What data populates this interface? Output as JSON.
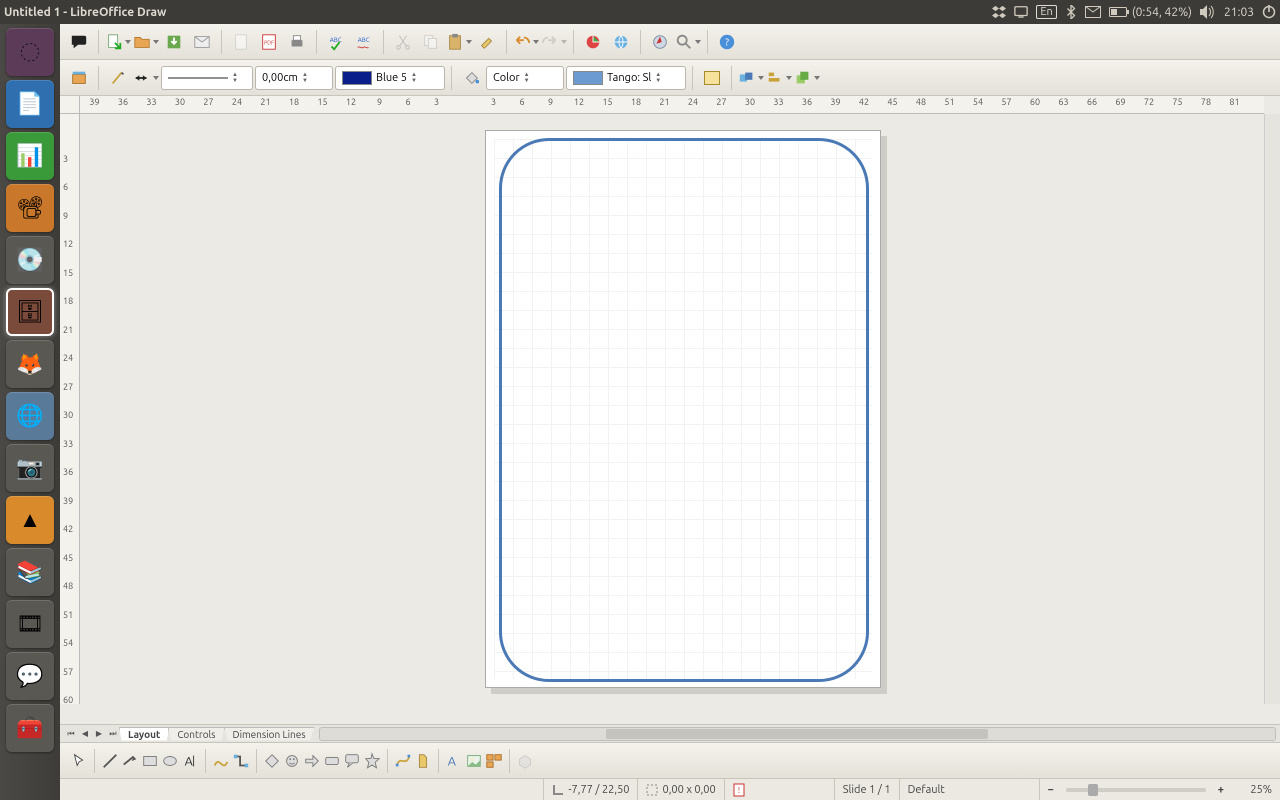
{
  "menubar": {
    "title": "Untitled 1 - LibreOffice Draw",
    "lang": "En",
    "battery": "(0:54, 42%)",
    "clock": "21:03"
  },
  "launcher": {
    "items": [
      {
        "name": "dash",
        "glyph": "◌"
      },
      {
        "name": "writer",
        "glyph": "📄"
      },
      {
        "name": "calc",
        "glyph": "📊"
      },
      {
        "name": "impress",
        "glyph": "📽"
      },
      {
        "name": "disk",
        "glyph": "💽"
      },
      {
        "name": "files",
        "glyph": "🗄"
      },
      {
        "name": "gimp",
        "glyph": "🦊"
      },
      {
        "name": "chromium",
        "glyph": "🌐"
      },
      {
        "name": "camera",
        "glyph": "📷"
      },
      {
        "name": "vlc",
        "glyph": "▲"
      },
      {
        "name": "books",
        "glyph": "📚"
      },
      {
        "name": "media",
        "glyph": "🎞"
      },
      {
        "name": "pidgin",
        "glyph": "💬"
      },
      {
        "name": "store",
        "glyph": "🧰"
      }
    ],
    "selected": 5
  },
  "toolbars": {
    "line_width": "0,00cm",
    "line_color_label": "Blue 5",
    "fill_mode": "Color",
    "fill_color_label": "Tango: Sl"
  },
  "ruler": {
    "h_labels": [
      "39",
      "36",
      "33",
      "30",
      "27",
      "24",
      "21",
      "18",
      "15",
      "12",
      "9",
      "6",
      "3",
      "",
      "3",
      "6",
      "9",
      "12",
      "15",
      "18",
      "21",
      "24",
      "27",
      "30",
      "33",
      "36",
      "39",
      "42",
      "45",
      "48",
      "51",
      "54",
      "57",
      "60",
      "63",
      "66",
      "69",
      "72",
      "75",
      "78",
      "81"
    ],
    "v_labels": [
      "",
      "3",
      "6",
      "9",
      "12",
      "15",
      "18",
      "21",
      "24",
      "27",
      "30",
      "33",
      "36",
      "39",
      "42",
      "45",
      "48",
      "51",
      "54",
      "57",
      "60"
    ]
  },
  "tabs": {
    "items": [
      "Layout",
      "Controls",
      "Dimension Lines"
    ],
    "active": 0
  },
  "status": {
    "cursor_pos": "-7,77 / 22,50",
    "obj_size": "0,00 x 0,00",
    "slide": "Slide 1 / 1",
    "master": "Default",
    "zoom": "25%"
  }
}
